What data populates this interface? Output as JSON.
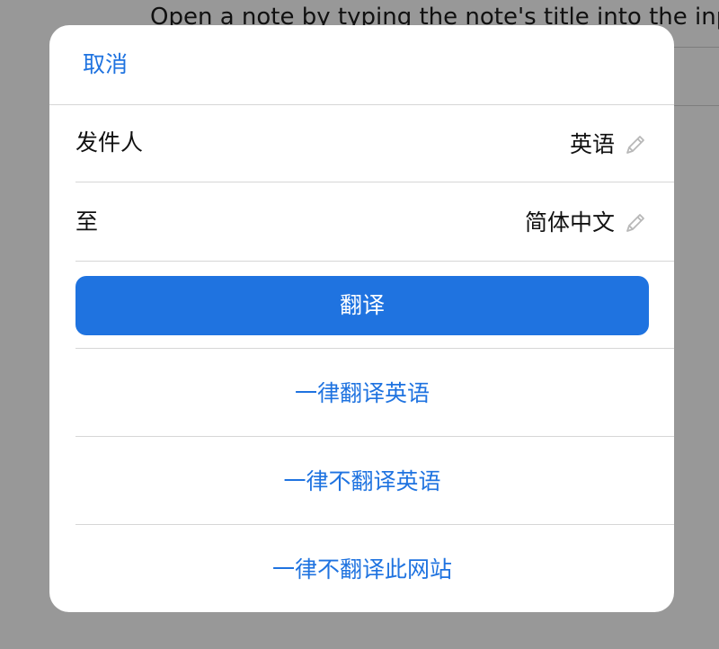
{
  "background": {
    "instruction_text": "Open a note by typing the note's title into the inp"
  },
  "dialog": {
    "cancel_label": "取消",
    "from": {
      "label": "发件人",
      "value": "英语"
    },
    "to": {
      "label": "至",
      "value": "简体中文"
    },
    "translate_label": "翻译",
    "actions": [
      {
        "label": "一律翻译英语"
      },
      {
        "label": "一律不翻译英语"
      },
      {
        "label": "一律不翻译此网站"
      }
    ]
  },
  "colors": {
    "accent": "#1f73e0",
    "overlay": "#989898",
    "separator": "#d6d6d6",
    "icon": "#b8b8b8"
  },
  "icons": {
    "edit": "pencil-icon"
  }
}
